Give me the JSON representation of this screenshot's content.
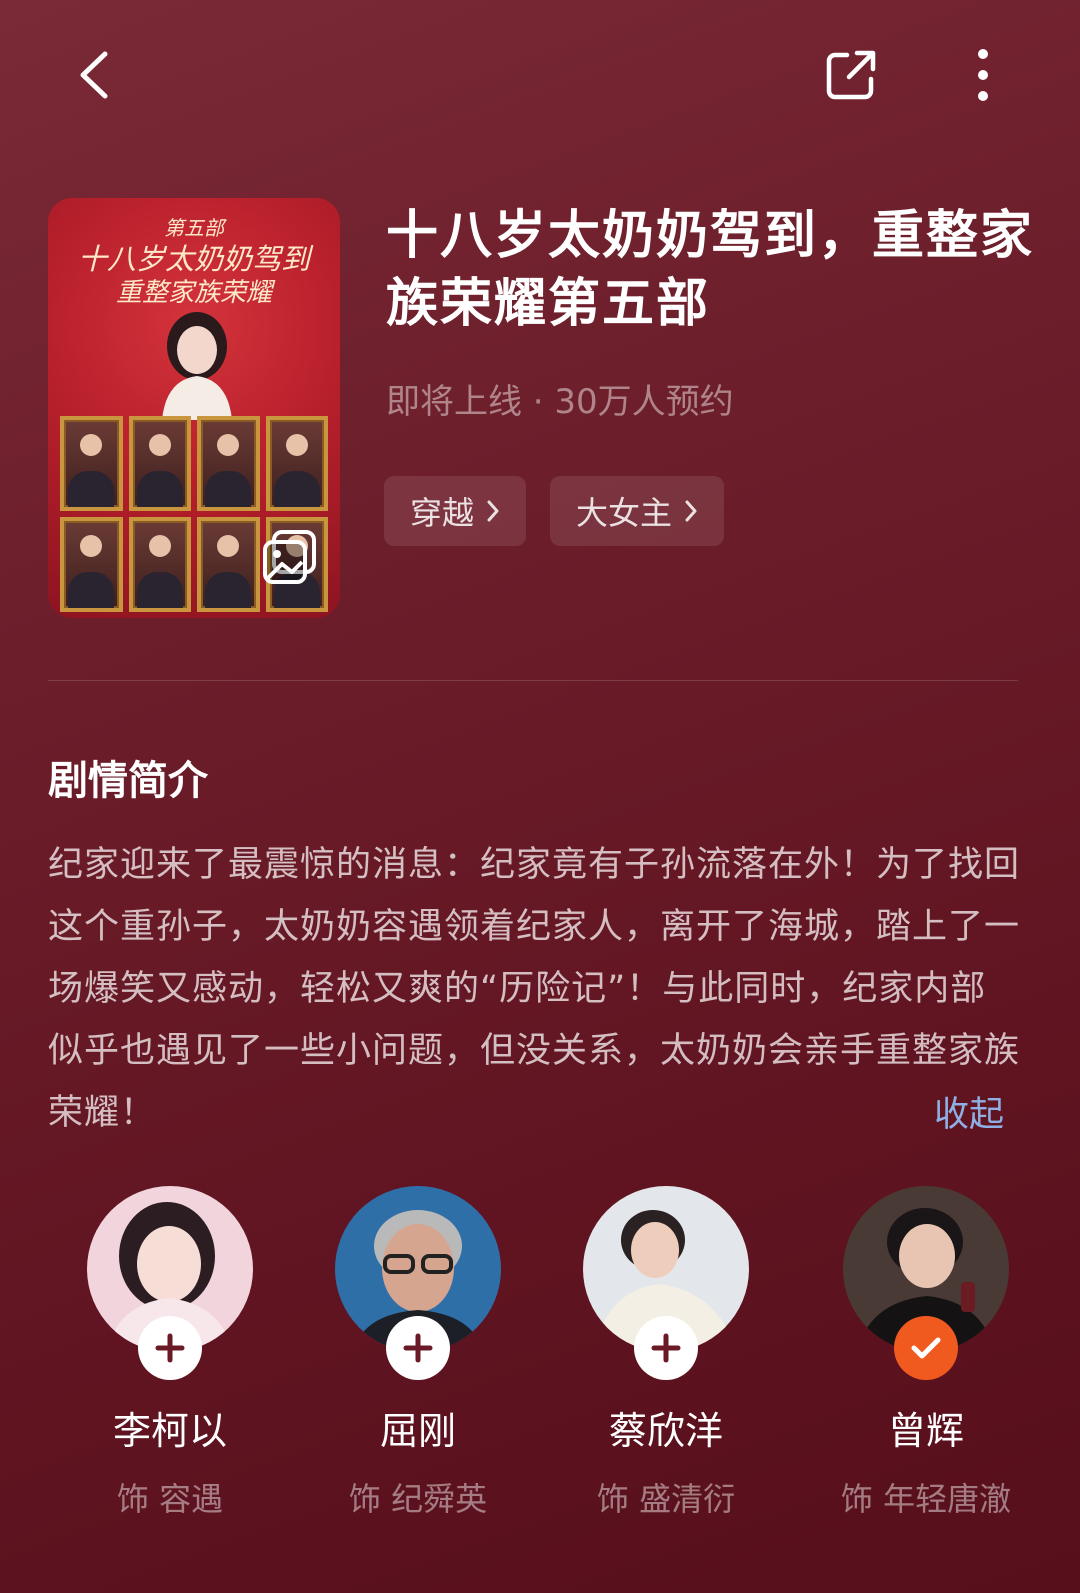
{
  "header": {
    "back_icon": "back-arrow-icon",
    "share_icon": "share-icon",
    "more_icon": "more-vertical-icon"
  },
  "poster": {
    "line1": "第五部",
    "line2": "十八岁太奶奶驾到",
    "line3": "重整家族荣耀",
    "gallery_icon": "gallery-icon"
  },
  "drama": {
    "title": "十八岁太奶奶驾到，重整家族荣耀第五部",
    "meta": "即将上线 · 30万人预约",
    "tags": [
      {
        "label": "穿越"
      },
      {
        "label": "大女主"
      }
    ]
  },
  "synopsis": {
    "heading": "剧情简介",
    "text": "纪家迎来了最震惊的消息：纪家竟有子孙流落在外！为了找回这个重孙子，太奶奶容遇领着纪家人，离开了海城，踏上了一场爆笑又感动，轻松又爽的“历险记”！与此同时，纪家内部似乎也遇见了一些小问题，但没关系，太奶奶会亲手重整家族荣耀！",
    "collapse_label": "收起"
  },
  "cast": [
    {
      "name": "李柯以",
      "role": "饰 容遇",
      "followed": false
    },
    {
      "name": "屈刚",
      "role": "饰 纪舜英",
      "followed": false
    },
    {
      "name": "蔡欣洋",
      "role": "饰 盛清衍",
      "followed": false
    },
    {
      "name": "曾辉",
      "role": "饰 年轻唐澈",
      "followed": true
    }
  ],
  "colors": {
    "background": "#6a1a27",
    "accent": "#f05a1e",
    "link": "#8fb0e4"
  }
}
